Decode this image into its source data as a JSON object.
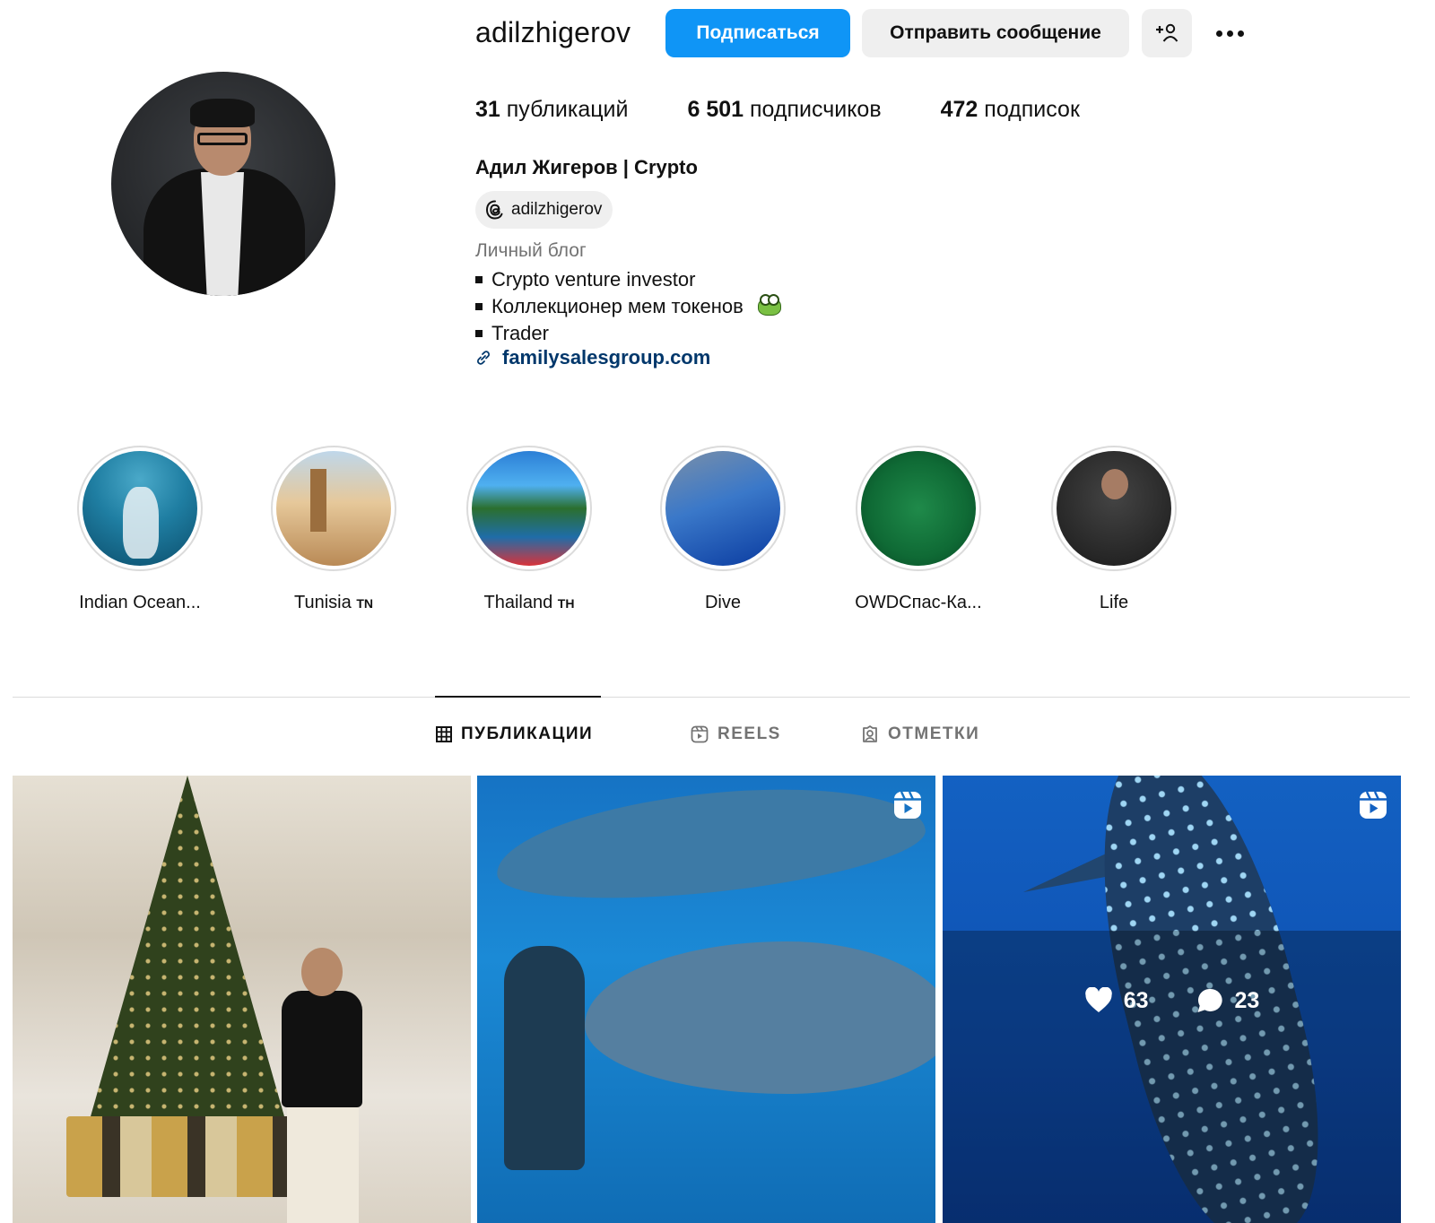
{
  "profile": {
    "username": "adilzhigerov",
    "follow_label": "Подписаться",
    "message_label": "Отправить сообщение",
    "add_icon": "add-user-icon",
    "more_icon": "more-icon",
    "posts_count": "31",
    "posts_label": "публикаций",
    "followers_count": "6 501",
    "followers_label": "подписчиков",
    "following_count": "472",
    "following_label": "подписок",
    "full_name": "Адил Жигеров | Crypto",
    "threads_handle": "adilzhigerov",
    "category": "Личный блог",
    "bio": [
      "Crypto venture investor",
      "Коллекционер мем токенов",
      "Trader"
    ],
    "link": "familysalesgroup.com"
  },
  "highlights": [
    {
      "label": "Indian Ocean..."
    },
    {
      "label": "Tunisia",
      "flag": "TN"
    },
    {
      "label": "Thailand",
      "flag": "TH"
    },
    {
      "label": "Dive"
    },
    {
      "label": "OWDСпас-Ка..."
    },
    {
      "label": "Life"
    }
  ],
  "tabs": {
    "posts": "ПУБЛИКАЦИИ",
    "reels": "REELS",
    "tagged": "ОТМЕТКИ",
    "active": "posts"
  },
  "posts": [
    {
      "type": "photo"
    },
    {
      "type": "reel"
    },
    {
      "type": "reel",
      "likes": "63",
      "comments": "23"
    }
  ],
  "colors": {
    "accent": "#0f95f6",
    "link": "#00376b",
    "secondary_text": "#737373"
  }
}
